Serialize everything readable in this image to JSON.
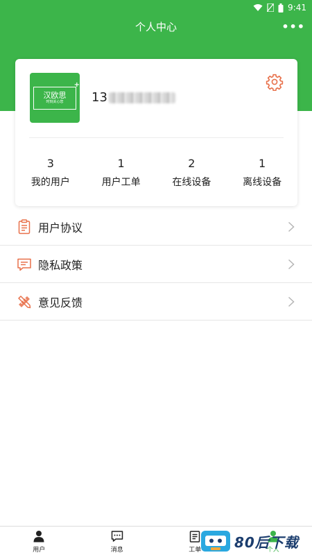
{
  "status_bar": {
    "time": "9:41"
  },
  "header": {
    "title": "个人中心",
    "more_label": "•••"
  },
  "profile": {
    "logo_main": "汉欧思",
    "logo_sub": "时刻关心您",
    "logo_plus": "+",
    "phone_prefix": "13"
  },
  "stats": [
    {
      "value": "3",
      "label": "我的用户"
    },
    {
      "value": "1",
      "label": "用户工单"
    },
    {
      "value": "2",
      "label": "在线设备"
    },
    {
      "value": "1",
      "label": "离线设备"
    }
  ],
  "menu": [
    {
      "label": "用户协议",
      "icon": "clipboard-icon"
    },
    {
      "label": "隐私政策",
      "icon": "message-icon"
    },
    {
      "label": "意见反馈",
      "icon": "pencil-ruler-icon"
    }
  ],
  "tabs": [
    {
      "label": "用户",
      "icon": "person-icon"
    },
    {
      "label": "消息",
      "icon": "chat-icon"
    },
    {
      "label": "工单",
      "icon": "clipboard-icon"
    },
    {
      "label": "个人",
      "icon": "person-icon"
    }
  ],
  "watermark": {
    "text": "80后下载"
  },
  "colors": {
    "brand": "#3cb54a",
    "accent": "#e8704a"
  }
}
